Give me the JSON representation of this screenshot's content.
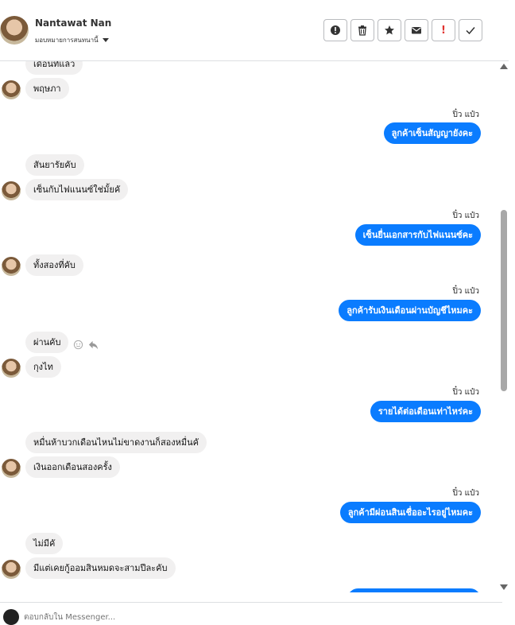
{
  "header": {
    "contact_name": "Nantawat Nan",
    "assign_label": "มอบหมายการสนทนานี้",
    "actions": [
      "spam-icon",
      "trash-icon",
      "star-icon",
      "envelope-icon",
      "follow-up-icon",
      "done-icon"
    ],
    "follow_up_label": "!"
  },
  "messages": [
    {
      "dir": "in",
      "text": "เดือนที่แล้ว"
    },
    {
      "dir": "in",
      "text": "พฤษภา"
    },
    {
      "dir": "out",
      "sender": "ปิ๋ว แป๋ว",
      "text": "ลูกค้าเซ็นสัญญายังคะ"
    },
    {
      "dir": "in",
      "text": "สันยารัยคับ"
    },
    {
      "dir": "in",
      "text": "เซ็นกับไฟแนนซ์ใช่มั้ยคั"
    },
    {
      "dir": "out",
      "sender": "ปิ๋ว แป๋ว",
      "text": "เซ็นยื่นเอกสารกับไฟแนนซ์คะ"
    },
    {
      "dir": "in",
      "text": "ทั้งสองที่คับ"
    },
    {
      "dir": "out",
      "sender": "ปิ๋ว แป๋ว",
      "text": "ลูกค้ารับเงินเดือนผ่านบัญชีไหมคะ"
    },
    {
      "dir": "in",
      "text": "ผ่านคับ"
    },
    {
      "dir": "in",
      "text": "กุงไท"
    },
    {
      "dir": "out",
      "sender": "ปิ๋ว แป๋ว",
      "text": "รายได้ต่อเดือนเท่าไหร่คะ"
    },
    {
      "dir": "in",
      "text": "หมื่นห้าบวกเดือนไหนไม่ขาดงานก็สองหมื่นคั"
    },
    {
      "dir": "in",
      "text": "เงินออกเดือนสองครั้ง"
    },
    {
      "dir": "out",
      "sender": "ปิ๋ว แป๋ว",
      "text": "ลูกค้ามีผ่อนสินเชื่ออะไรอยู่ไหมคะ"
    },
    {
      "dir": "in",
      "text": "ไม่มีคั"
    },
    {
      "dir": "in",
      "text": "มีแต่เคยกู้ออมสินหมดจะสามปีละคับ"
    }
  ],
  "composer": {
    "placeholder": "ตอบกลับใน Messenger..."
  },
  "colors": {
    "outgoing_bubble": "#0a7cff",
    "incoming_bubble": "#f1f0f0"
  }
}
